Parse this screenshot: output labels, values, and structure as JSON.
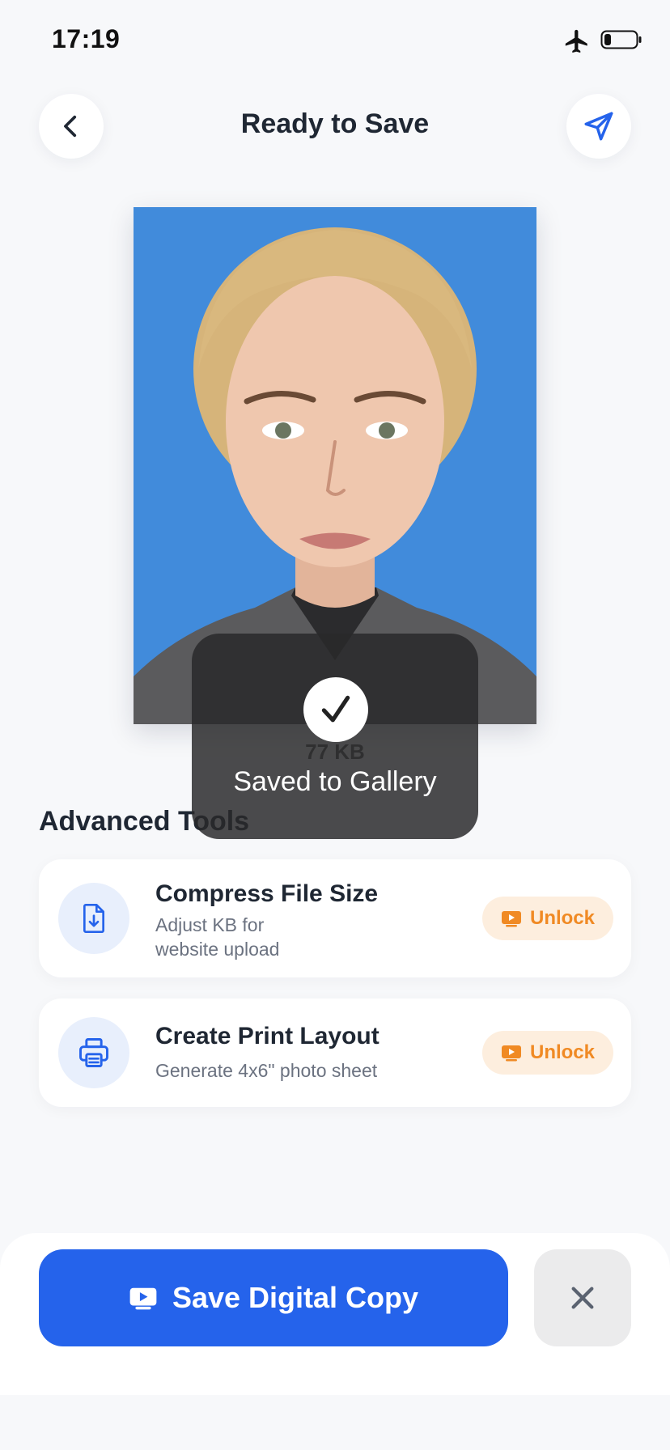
{
  "status_bar": {
    "time": "17:19",
    "icons": [
      "airplane-icon",
      "battery-icon"
    ]
  },
  "header": {
    "title": "Ready to Save",
    "back_icon": "chevron-left-icon",
    "share_icon": "send-icon"
  },
  "photo": {
    "file_size": "77 KB",
    "background_color": "#418bdb"
  },
  "advanced_tools": {
    "title": "Advanced Tools",
    "items": [
      {
        "title": "Compress File Size",
        "description": "Adjust KB for website upload",
        "icon": "file-download-icon",
        "action_label": "Unlock",
        "action_icon": "video-play-icon"
      },
      {
        "title": "Create Print Layout",
        "description": "Generate 4x6\" photo sheet",
        "icon": "printer-icon",
        "action_label": "Unlock",
        "action_icon": "video-play-icon"
      }
    ]
  },
  "bottom_bar": {
    "save_label": "Save Digital Copy",
    "save_icon": "video-play-icon",
    "close_icon": "close-icon"
  },
  "toast": {
    "message": "Saved to Gallery",
    "icon": "checkmark-icon"
  },
  "colors": {
    "accent": "#2563eb",
    "unlock_text": "#f08a24",
    "unlock_bg": "#fdeede",
    "page_bg": "#f7f8fa"
  }
}
